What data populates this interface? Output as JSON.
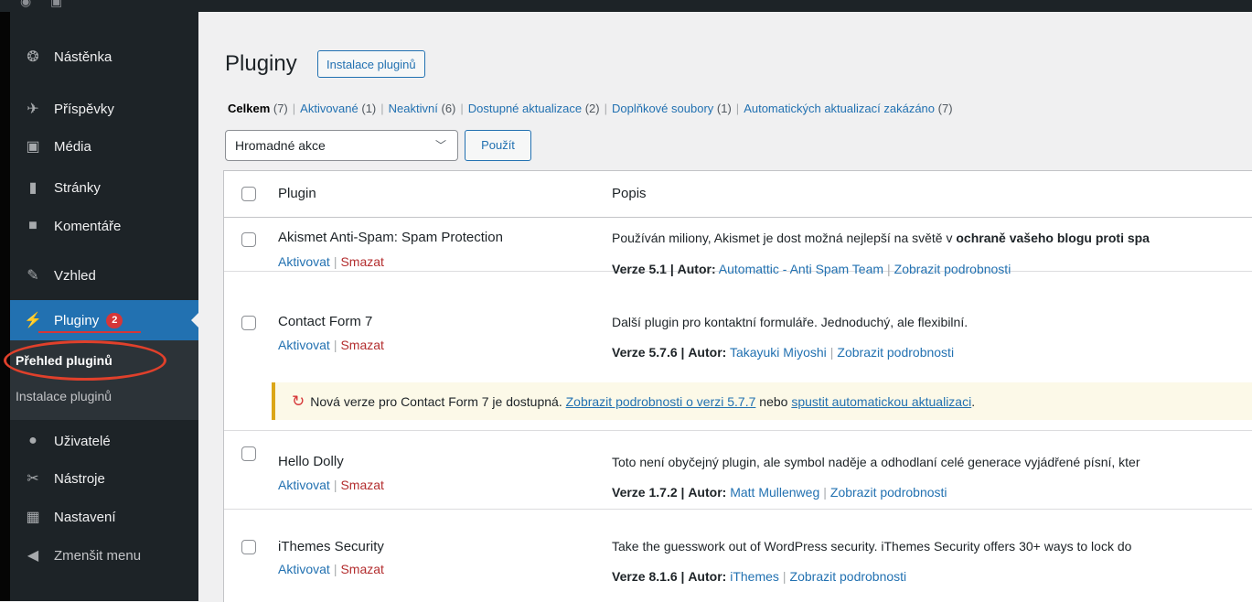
{
  "sidebar": {
    "items": [
      {
        "label": "Nástěnka",
        "icon": "dashboard-icon",
        "glyph": "❂"
      },
      {
        "label": "Příspěvky",
        "icon": "pin-icon",
        "glyph": "✈"
      },
      {
        "label": "Média",
        "icon": "media-icon",
        "glyph": "▣"
      },
      {
        "label": "Stránky",
        "icon": "pages-icon",
        "glyph": "▮"
      },
      {
        "label": "Komentáře",
        "icon": "comments-icon",
        "glyph": "■"
      },
      {
        "label": "Vzhled",
        "icon": "appearance-icon",
        "glyph": "✎"
      },
      {
        "label": "Pluginy",
        "icon": "plugins-icon",
        "glyph": "⚡",
        "badge": "2"
      },
      {
        "label": "Uživatelé",
        "icon": "users-icon",
        "glyph": "●"
      },
      {
        "label": "Nástroje",
        "icon": "tools-icon",
        "glyph": "✂"
      },
      {
        "label": "Nastavení",
        "icon": "settings-icon",
        "glyph": "▦"
      },
      {
        "label": "Zmenšit menu",
        "icon": "collapse-icon",
        "glyph": "◀"
      }
    ],
    "submenu": [
      {
        "label": "Přehled pluginů"
      },
      {
        "label": "Instalace pluginů"
      }
    ]
  },
  "header": {
    "title": "Pluginy",
    "add_new_label": "Instalace pluginů"
  },
  "filters": [
    {
      "label": "Celkem",
      "count": "(7)"
    },
    {
      "label": "Aktivované",
      "count": "(1)"
    },
    {
      "label": "Neaktivní",
      "count": "(6)"
    },
    {
      "label": "Dostupné aktualizace",
      "count": "(2)"
    },
    {
      "label": "Doplňkové soubory",
      "count": "(1)"
    },
    {
      "label": "Automatických aktualizací zakázáno",
      "count": "(7)"
    }
  ],
  "bulk": {
    "selected": "Hromadné akce",
    "apply_label": "Použít"
  },
  "table": {
    "col_plugin": "Plugin",
    "col_desc": "Popis",
    "plugins": [
      {
        "name": "Akismet Anti-Spam: Spam Protection",
        "activate": "Aktivovat",
        "delete": "Smazat",
        "desc_plain": "Používán miliony, Akismet je dost možná nejlepší na světě v ",
        "desc_bold": "ochraně vašeho blogu proti spa",
        "version_label": "Verze 5.1 |",
        "author_label": "Autor:",
        "author": "Automattic - Anti Spam Team",
        "details": "Zobrazit podrobnosti"
      },
      {
        "name": "Contact Form 7",
        "activate": "Aktivovat",
        "delete": "Smazat",
        "desc_plain": "Další plugin pro kontaktní formuláře. Jednoduchý, ale flexibilní.",
        "desc_bold": "",
        "version_label": "Verze 5.7.6 |",
        "author_label": "Autor:",
        "author": "Takayuki Miyoshi",
        "details": "Zobrazit podrobnosti"
      },
      {
        "name": "Hello Dolly",
        "activate": "Aktivovat",
        "delete": "Smazat",
        "desc_plain": "Toto není obyčejný plugin, ale symbol naděje a odhodlaní celé generace vyjádřené písní, kter",
        "desc_bold": "",
        "version_label": "Verze 1.7.2 |",
        "author_label": "Autor:",
        "author": "Matt Mullenweg",
        "details": "Zobrazit podrobnosti"
      },
      {
        "name": "iThemes Security",
        "activate": "Aktivovat",
        "delete": "Smazat",
        "desc_plain": "Take the guesswork out of WordPress security. iThemes Security offers 30+ ways to lock do",
        "desc_bold": "",
        "version_label": "Verze 8.1.6 |",
        "author_label": "Autor:",
        "author": "iThemes",
        "details": "Zobrazit podrobnosti"
      }
    ],
    "update_notice": {
      "text1": "Nová verze pro Contact Form 7 je dostupná. ",
      "link1": "Zobrazit podrobnosti o verzi 5.7.7",
      "text2": " nebo ",
      "link2": "spustit automatickou aktualizaci",
      "text3": "."
    }
  },
  "colors": {
    "accent": "#2271b1",
    "sidebar": "#1d2327",
    "delete": "#b32d2e",
    "badge": "#d63638",
    "highlight": "#e0402b"
  }
}
